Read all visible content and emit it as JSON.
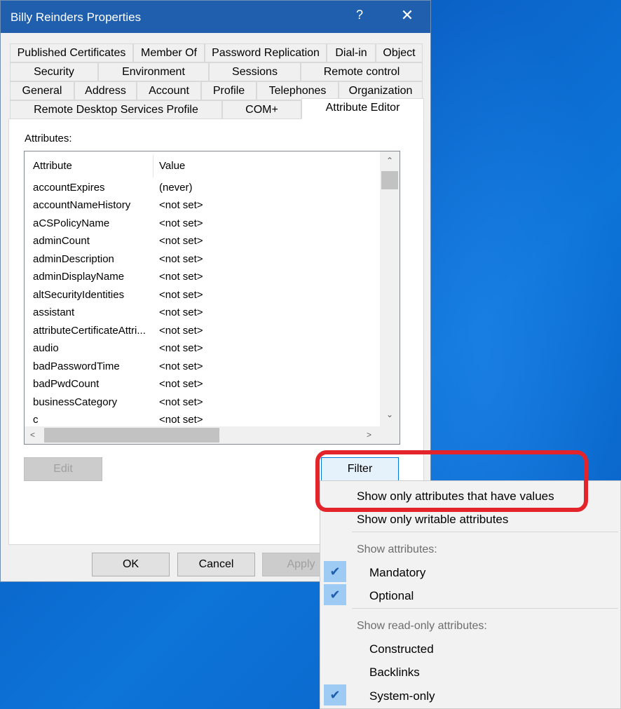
{
  "window": {
    "title": "Billy Reinders Properties",
    "help_label": "?",
    "close_label": "✕",
    "colors": {
      "titlebar": "#1f5fae",
      "highlight": "#e3242b",
      "check_bg": "#9ecbf4"
    }
  },
  "tabs": {
    "row1": [
      "Published Certificates",
      "Member Of",
      "Password Replication",
      "Dial-in",
      "Object"
    ],
    "row2": [
      "Security",
      "Environment",
      "Sessions",
      "Remote control"
    ],
    "row3": [
      "General",
      "Address",
      "Account",
      "Profile",
      "Telephones",
      "Organization"
    ],
    "row4": [
      "Remote Desktop Services Profile",
      "COM+",
      "Attribute Editor"
    ]
  },
  "attributes": {
    "label": "Attributes:",
    "columns": [
      "Attribute",
      "Value"
    ],
    "rows": [
      {
        "attr": "accountExpires",
        "value": "(never)"
      },
      {
        "attr": "accountNameHistory",
        "value": "<not set>"
      },
      {
        "attr": "aCSPolicyName",
        "value": "<not set>"
      },
      {
        "attr": "adminCount",
        "value": "<not set>"
      },
      {
        "attr": "adminDescription",
        "value": "<not set>"
      },
      {
        "attr": "adminDisplayName",
        "value": "<not set>"
      },
      {
        "attr": "altSecurityIdentities",
        "value": "<not set>"
      },
      {
        "attr": "assistant",
        "value": "<not set>"
      },
      {
        "attr": "attributeCertificateAttri...",
        "value": "<not set>"
      },
      {
        "attr": "audio",
        "value": "<not set>"
      },
      {
        "attr": "badPasswordTime",
        "value": "<not set>"
      },
      {
        "attr": "badPwdCount",
        "value": "<not set>"
      },
      {
        "attr": "businessCategory",
        "value": "<not set>"
      },
      {
        "attr": "c",
        "value": "<not set>"
      }
    ]
  },
  "buttons": {
    "edit": "Edit",
    "filter": "Filter",
    "ok": "OK",
    "cancel": "Cancel",
    "apply": "Apply"
  },
  "filter_menu": {
    "show_values": "Show only attributes that have values",
    "show_writable": "Show only writable attributes",
    "show_attributes_header": "Show attributes:",
    "mandatory": "Mandatory",
    "optional": "Optional",
    "read_only_header": "Show read-only attributes:",
    "constructed": "Constructed",
    "backlinks": "Backlinks",
    "system_only": "System-only",
    "check_glyph": "✔"
  }
}
